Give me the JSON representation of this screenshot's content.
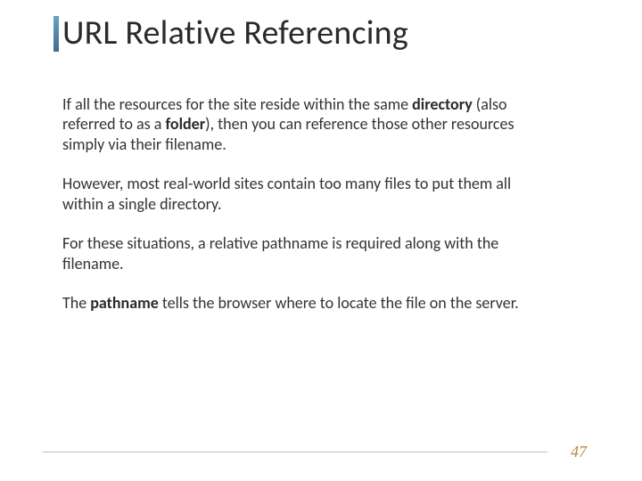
{
  "title": "URL Relative Referencing",
  "para1": {
    "seg1": "If all the resources for the site reside within the same ",
    "b1": "directory",
    "seg2": " (also referred to as a ",
    "b2": "folder",
    "seg3": "), then you can reference those other resources simply via their filename."
  },
  "para2": "However, most real-world sites contain too many files to put them all within a single directory.",
  "para3": "For these situations, a relative pathname is required along with the filename.",
  "para4": {
    "seg1": "The ",
    "b1": "pathname",
    "seg2": " tells the browser where to locate the file on the server."
  },
  "page_number": "47"
}
